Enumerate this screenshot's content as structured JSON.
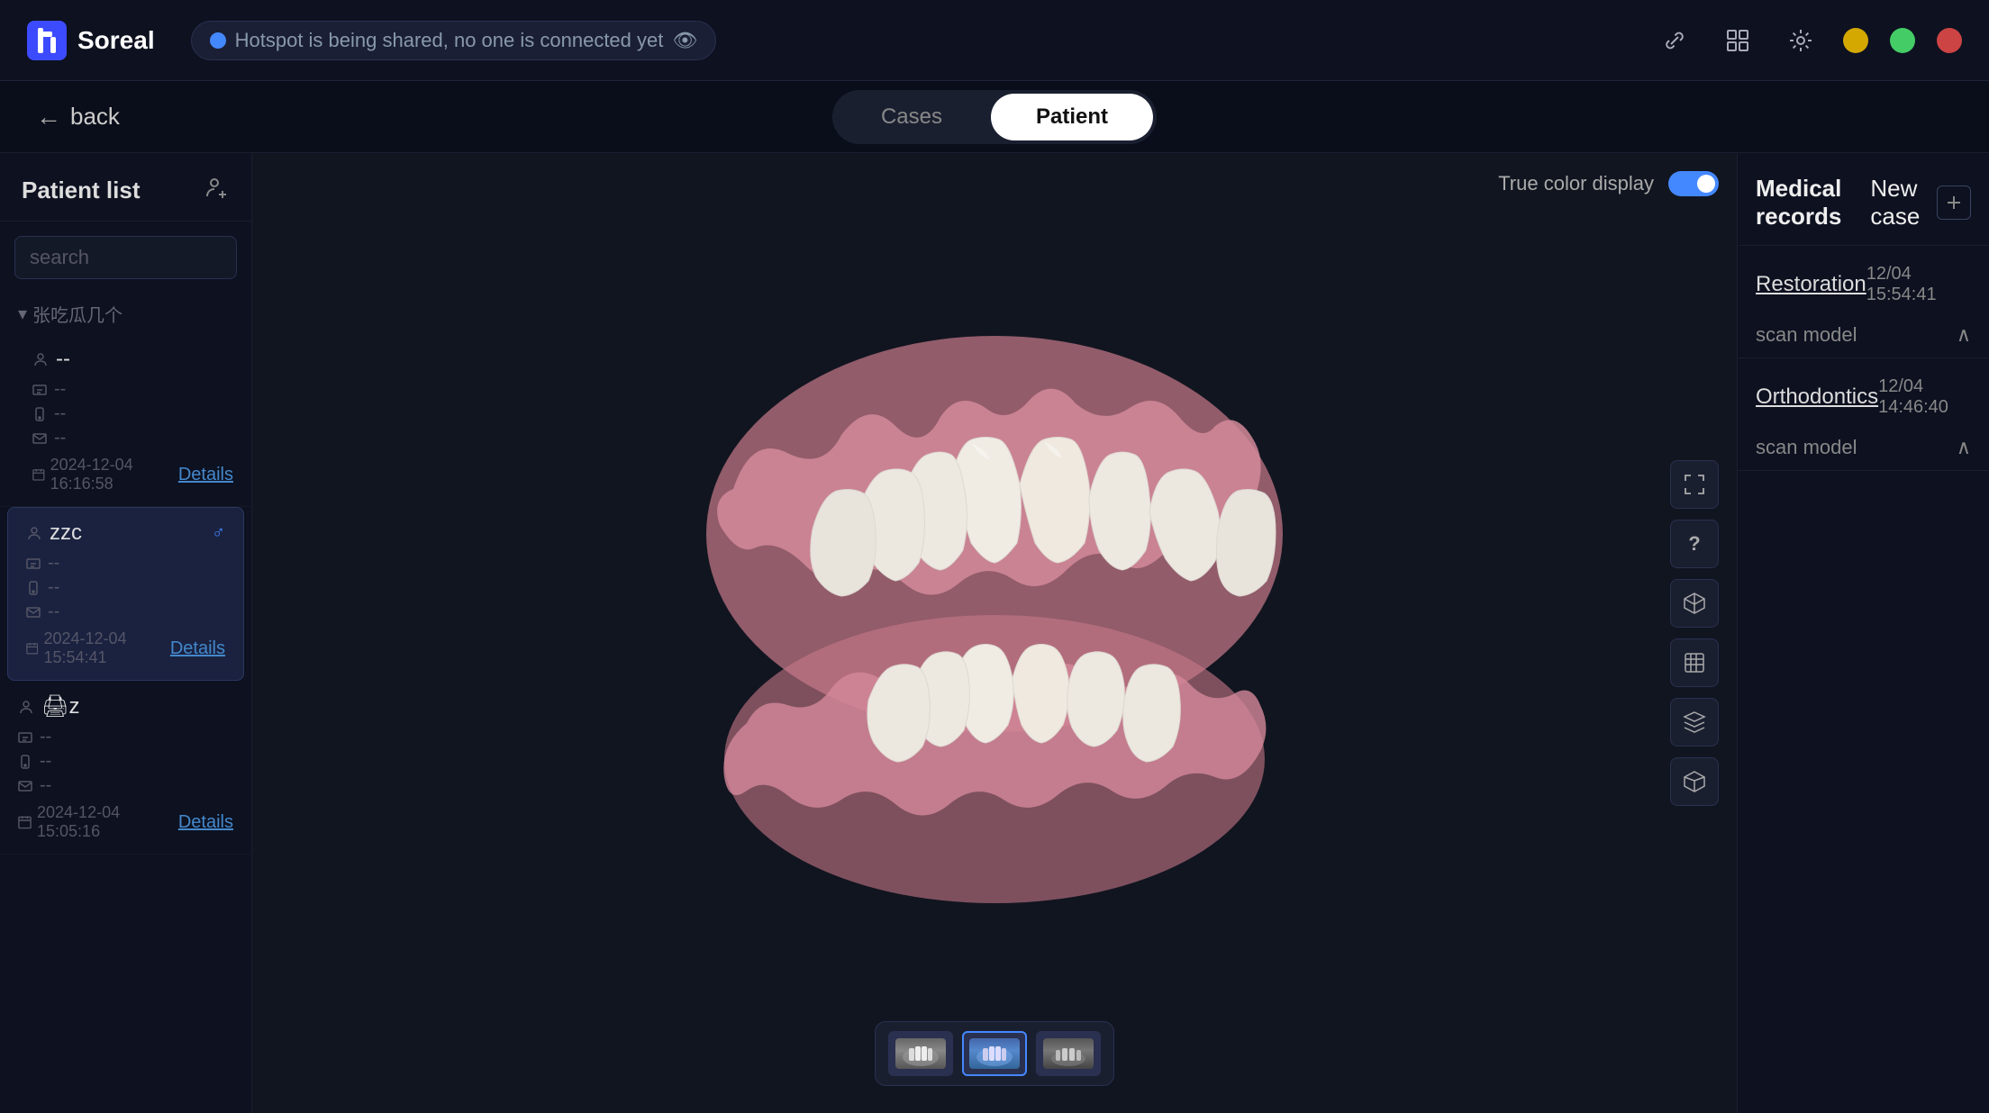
{
  "app": {
    "logo_icon": "D",
    "logo_text": "Soreal"
  },
  "topbar": {
    "hotspot_text": "Hotspot is being shared, no one is connected yet",
    "eye_icon": "👁",
    "link_icon": "🔗",
    "grid_icon": "⊞",
    "settings_icon": "⚙"
  },
  "navigation": {
    "back_label": "back",
    "tabs": [
      {
        "id": "cases",
        "label": "Cases",
        "active": false
      },
      {
        "id": "patient",
        "label": "Patient",
        "active": true
      }
    ]
  },
  "sidebar": {
    "title": "Patient list",
    "search_placeholder": "search",
    "add_icon": "person+",
    "patients": [
      {
        "id": "group1",
        "group_name": "张吃瓜几个",
        "name": "--",
        "dob": "--",
        "phone": "--",
        "email": "--",
        "date": "2024-12-04 16:16:58",
        "details_label": "Details",
        "active": false
      },
      {
        "id": "zzc",
        "name": "zzc",
        "dob": "--",
        "phone": "--",
        "email": "--",
        "date": "2024-12-04 15:54:41",
        "details_label": "Details",
        "active": true,
        "gender": "♂"
      },
      {
        "id": "z2",
        "name": "墨z",
        "dob": "--",
        "phone": "--",
        "email": "--",
        "date": "2024-12-04 15:05:16",
        "details_label": "Details",
        "active": false
      }
    ]
  },
  "viewer": {
    "true_color_label": "True color display",
    "toggle_on": true,
    "controls": [
      "⛶",
      "?",
      "⬚",
      "⬚",
      "⬚",
      "⬚"
    ],
    "thumbnails": [
      {
        "id": "thumb1",
        "active": false
      },
      {
        "id": "thumb2",
        "active": true
      },
      {
        "id": "thumb3",
        "active": false
      }
    ]
  },
  "right_sidebar": {
    "medical_records_label": "Medical\nrecords",
    "new_case_label": "New\ncase",
    "add_icon": "+",
    "records": [
      {
        "type": "Restoration",
        "date": "12/04 15:54:41",
        "sub_label": "scan model",
        "expanded": true
      },
      {
        "type": "Orthodontics",
        "date": "12/04 14:46:40",
        "sub_label": "scan model",
        "expanded": true
      }
    ]
  }
}
